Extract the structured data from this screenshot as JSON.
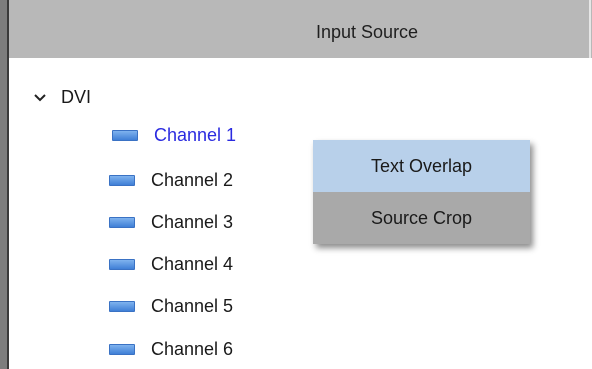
{
  "header": {
    "title": "Input Source"
  },
  "tree": {
    "group": {
      "label": "DVI",
      "expanded": true
    },
    "channels": [
      {
        "label": "Channel 1",
        "selected": true
      },
      {
        "label": "Channel 2",
        "selected": false
      },
      {
        "label": "Channel 3",
        "selected": false
      },
      {
        "label": "Channel 4",
        "selected": false
      },
      {
        "label": "Channel 5",
        "selected": false
      },
      {
        "label": "Channel 6",
        "selected": false
      }
    ]
  },
  "context_menu": {
    "items": [
      {
        "label": "Text Overlap",
        "highlighted": true
      },
      {
        "label": "Source Crop",
        "highlighted": false
      }
    ]
  },
  "colors": {
    "header_bg": "#b8b8b8",
    "selected_text": "#2a2ae0",
    "menu_bg": "#a9a9a9",
    "menu_highlight": "#b8d0ea",
    "channel_icon": "#4f8be0"
  },
  "icons": {
    "group_toggle": "chevron-down-icon",
    "channel": "video-channel-icon"
  }
}
